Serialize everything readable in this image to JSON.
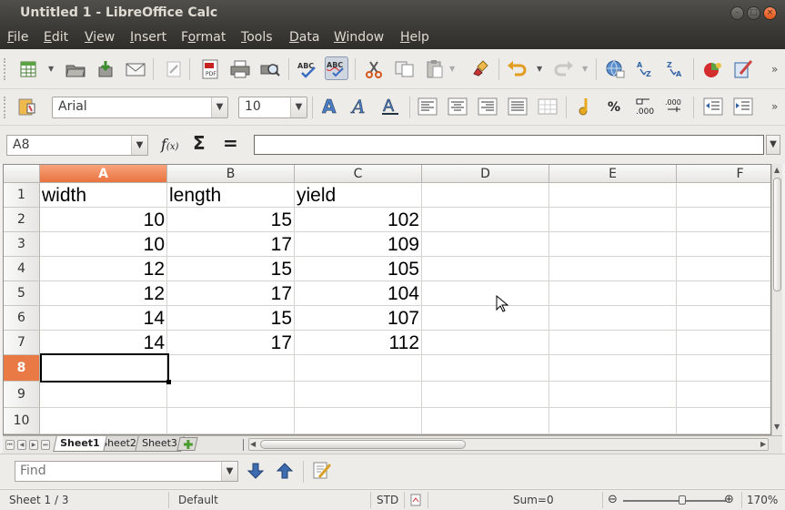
{
  "window": {
    "title": "Untitled 1 - LibreOffice Calc"
  },
  "menu": [
    {
      "label": "File",
      "u": "F",
      "rest": "ile"
    },
    {
      "label": "Edit",
      "u": "E",
      "rest": "dit"
    },
    {
      "label": "View",
      "u": "V",
      "rest": "iew"
    },
    {
      "label": "Insert",
      "u": "I",
      "rest": "nsert"
    },
    {
      "label": "Format",
      "u": "o",
      "pre": "F",
      "rest": "rmat"
    },
    {
      "label": "Tools",
      "u": "T",
      "rest": "ools"
    },
    {
      "label": "Data",
      "u": "D",
      "rest": "ata"
    },
    {
      "label": "Window",
      "u": "W",
      "rest": "indow"
    },
    {
      "label": "Help",
      "u": "H",
      "rest": "elp"
    }
  ],
  "formatting": {
    "font_name": "Arial",
    "font_size": "10"
  },
  "formula_bar": {
    "name_box": "A8",
    "content": ""
  },
  "grid": {
    "columns": [
      "A",
      "B",
      "C",
      "D",
      "E",
      "F"
    ],
    "rows": [
      "1",
      "2",
      "3",
      "4",
      "5",
      "6",
      "7",
      "8",
      "9",
      "10"
    ],
    "selected_column": "A",
    "selected_row": "8",
    "headers": [
      "width",
      "length",
      "yield"
    ],
    "data": [
      [
        "10",
        "15",
        "102"
      ],
      [
        "10",
        "17",
        "109"
      ],
      [
        "12",
        "15",
        "105"
      ],
      [
        "12",
        "17",
        "104"
      ],
      [
        "14",
        "15",
        "107"
      ],
      [
        "14",
        "17",
        "112"
      ]
    ]
  },
  "sheets": {
    "tabs": [
      "Sheet1",
      "Sheet2",
      "Sheet3"
    ],
    "active": "Sheet1"
  },
  "find": {
    "placeholder": "Find"
  },
  "status": {
    "sheet": "Sheet 1 / 3",
    "style": "Default",
    "mode": "STD",
    "sum": "Sum=0",
    "zoom": "170%"
  },
  "colors": {
    "selection_header": "#e9733f",
    "titlebar": "#3c3b37",
    "close_button": "#e1561b"
  }
}
